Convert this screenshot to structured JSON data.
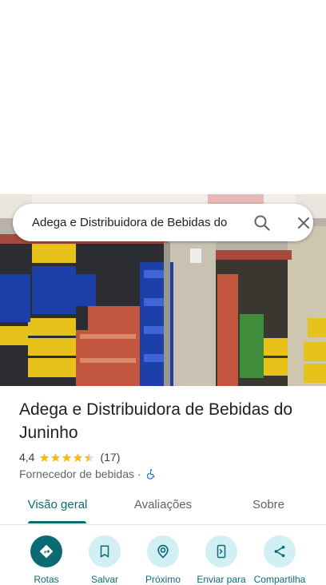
{
  "search": {
    "query": "Adega e Distribuidora de Bebidas do Juninho"
  },
  "place": {
    "name": "Adega e Distribuidora de Bebidas do Juninho",
    "rating": "4,4",
    "rating_value": 4.4,
    "rating_max": 5,
    "review_count": "(17)",
    "category": "Fornecedor de bebidas",
    "separator": "·"
  },
  "tabs": [
    {
      "label": "Visão geral",
      "active": true
    },
    {
      "label": "Avaliações",
      "active": false
    },
    {
      "label": "Sobre",
      "active": false
    }
  ],
  "actions": [
    {
      "label": "Rotas",
      "icon": "directions-icon"
    },
    {
      "label": "Salvar",
      "icon": "bookmark-icon"
    },
    {
      "label": "Próximo",
      "icon": "nearby-icon"
    },
    {
      "label": "Enviar para",
      "icon": "send-to-phone-icon"
    },
    {
      "label": "Compartilha",
      "icon": "share-icon"
    }
  ],
  "colors": {
    "accent": "#0b6b73",
    "action_bg": "#d2f0f4",
    "star": "#fbbc04"
  }
}
